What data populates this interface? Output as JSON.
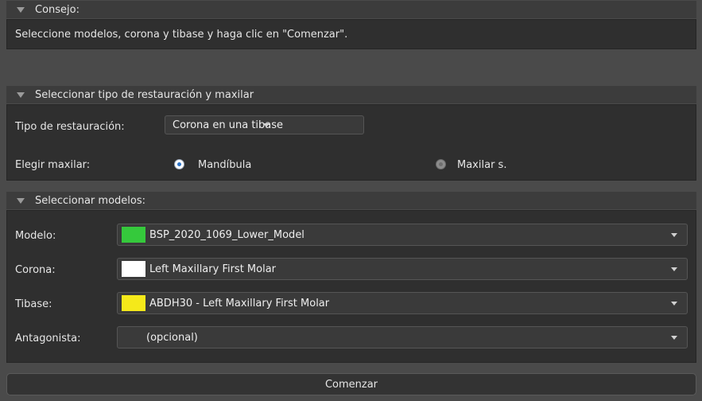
{
  "tip": {
    "header": "Consejo:",
    "text": "Seleccione modelos, corona y tibase y haga clic en \"Comenzar\"."
  },
  "restoration": {
    "header": "Seleccionar tipo de restauración y maxilar",
    "type_label": "Tipo de restauración:",
    "type_value": "Corona en una tibase",
    "jaw_label": "Elegir maxilar:",
    "jaw_options": [
      "Mandíbula",
      "Maxilar s."
    ],
    "jaw_selected": "Mandíbula"
  },
  "models": {
    "header": "Seleccionar modelos:",
    "rows": [
      {
        "label": "Modelo:",
        "value": "BSP_2020_1069_Lower_Model",
        "color": "#35c93c"
      },
      {
        "label": "Corona:",
        "value": "Left Maxillary First Molar",
        "color": "#ffffff"
      },
      {
        "label": "Tibase:",
        "value": "ABDH30 - Left Maxillary First Molar",
        "color": "#f5e91a"
      },
      {
        "label": "Antagonista:",
        "value": "(opcional)",
        "color": ""
      }
    ]
  },
  "start_button": "Comenzar"
}
